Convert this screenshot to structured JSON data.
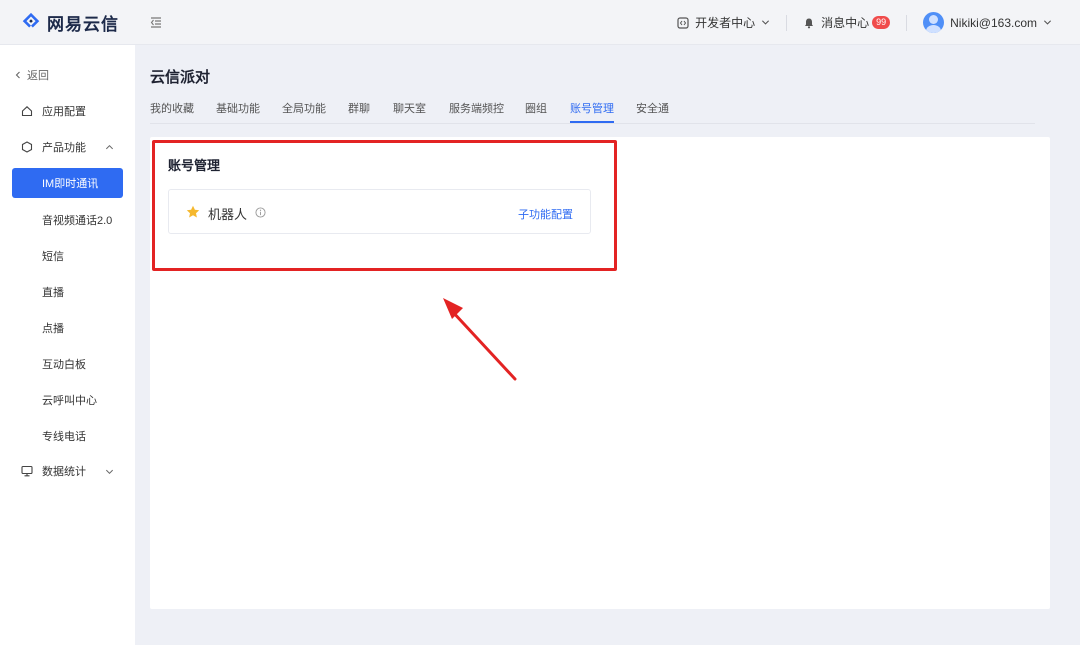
{
  "header": {
    "logo_text": "网易云信",
    "dev_center": "开发者中心",
    "messages": "消息中心",
    "message_count": "99",
    "user": "Nikiki@163.com"
  },
  "sidebar": {
    "back": "返回",
    "groups": [
      {
        "label": "应用配置",
        "icon": "home-icon"
      },
      {
        "label": "产品功能",
        "icon": "cube-icon"
      },
      {
        "label": "数据统计",
        "icon": "monitor-icon"
      }
    ],
    "active_item": "IM即时通讯",
    "sub_items": [
      "音视频通话2.0",
      "短信",
      "直播",
      "点播",
      "互动白板",
      "云呼叫中心",
      "专线电话"
    ]
  },
  "main": {
    "page_title": "云信派对",
    "tabs": [
      "我的收藏",
      "基础功能",
      "全局功能",
      "群聊",
      "聊天室",
      "服务端频控",
      "圈组",
      "账号管理",
      "安全通"
    ],
    "active_tab_index": 7,
    "section_title": "账号管理",
    "feature": {
      "name": "机器人",
      "link": "子功能配置",
      "favorited": true
    }
  },
  "colors": {
    "accent": "#2f6bf2",
    "highlight": "#e32323",
    "star": "#f5b82e",
    "badge": "#f04b4b"
  }
}
